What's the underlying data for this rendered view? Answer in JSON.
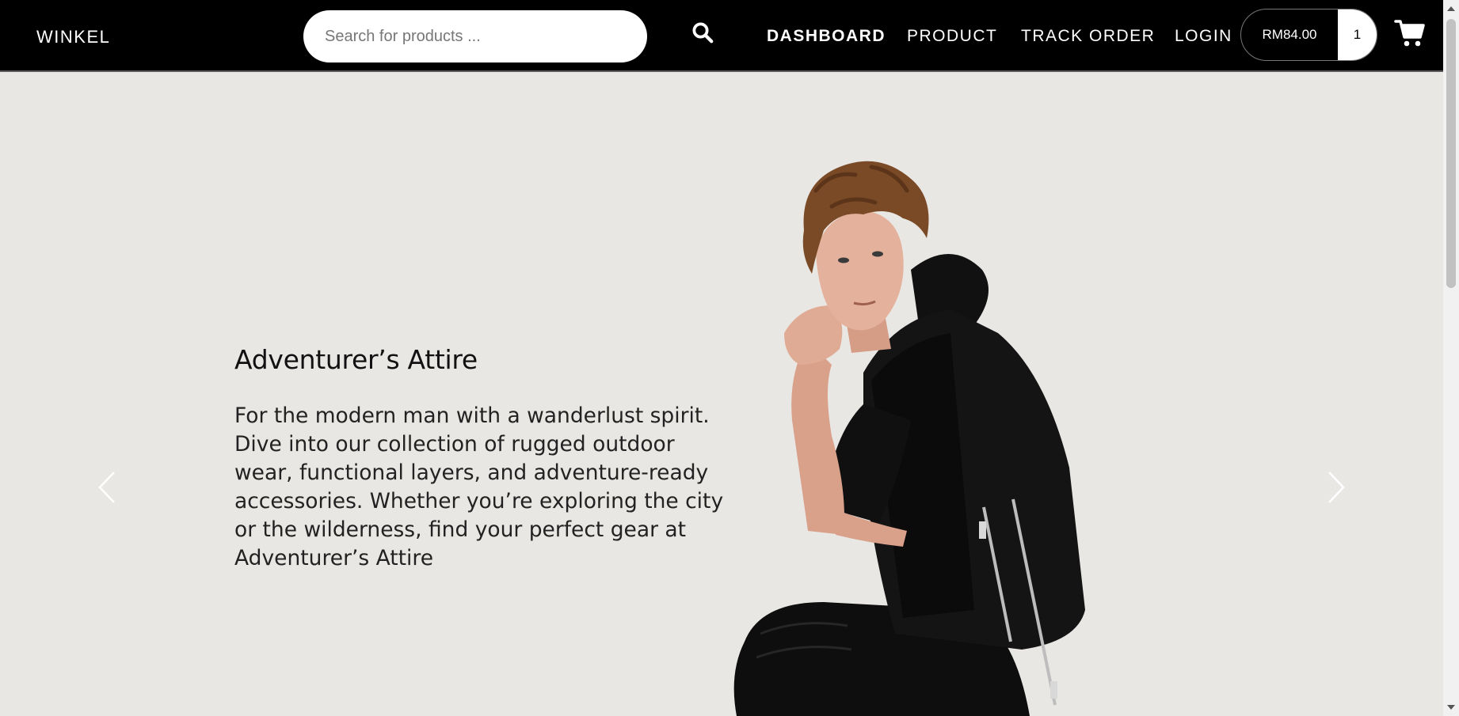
{
  "navbar": {
    "brand": "WINKEL",
    "search": {
      "placeholder": "Search for products ...",
      "value": ""
    },
    "search_icon": "search-icon",
    "links": [
      {
        "label": "DASHBOARD",
        "active": true
      },
      {
        "label": "PRODUCT",
        "active": false
      },
      {
        "label": "TRACK ORDER",
        "active": false
      },
      {
        "label": "LOGIN",
        "active": false
      }
    ],
    "cart": {
      "total": "RM84.00",
      "count": "1",
      "icon": "shopping-cart-icon"
    }
  },
  "hero": {
    "title": "Adventurer’s Attire",
    "description": "For the modern man with a wanderlust spirit. Dive into our collection of rugged outdoor wear, functional layers, and adventure-ready accessories. Whether you’re exploring the city or the wilderness, find your perfect gear at Adventurer’s Attire",
    "prev_icon": "chevron-left-icon",
    "next_icon": "chevron-right-icon",
    "image": "model-in-black-outfit-photo"
  },
  "colors": {
    "navbar_bg": "#000000",
    "hero_bg": "#e9e7e4",
    "text": "#111111"
  }
}
